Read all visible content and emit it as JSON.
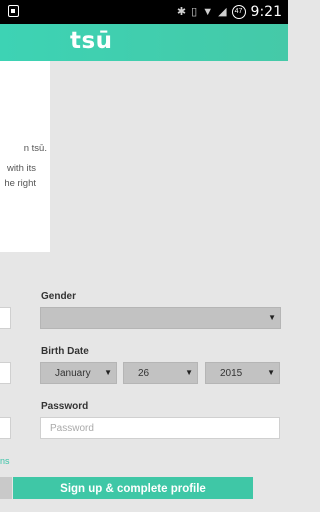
{
  "status_bar": {
    "battery_level": "47",
    "time": "9:21",
    "icons": [
      "notification-icon",
      "bluetooth-icon",
      "vibrate-icon",
      "wifi-icon",
      "signal-icon",
      "battery-icon"
    ]
  },
  "header": {
    "logo": "tsū"
  },
  "intro_card": {
    "line1": "n tsū.",
    "line2": "with its",
    "line3": "he right"
  },
  "form": {
    "gender_label": "Gender",
    "gender_value": "",
    "birth_label": "Birth Date",
    "birth_month": "January",
    "birth_day": "26",
    "birth_year": "2015",
    "password_label": "Password",
    "password_placeholder": "Password",
    "link_fragment": "ns",
    "submit_label": "Sign up & complete profile"
  },
  "colors": {
    "accent": "#3fc7a6",
    "header_gradient_start": "#3dd3b4",
    "select_bg": "#c2c2c2",
    "background": "#e6e6e6"
  }
}
